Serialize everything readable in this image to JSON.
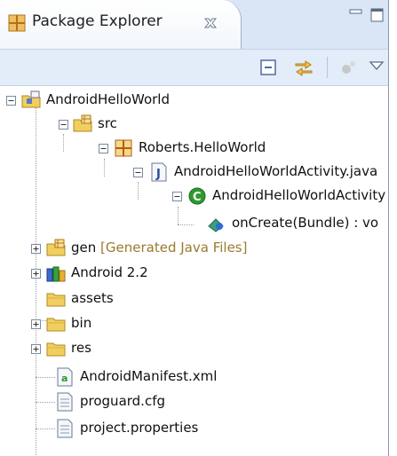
{
  "view": {
    "title": "Package Explorer",
    "tab_icon": "package-explorer-icon",
    "close_icon": "close-icon"
  },
  "toolbar": {
    "buttons": [
      "collapse-all-icon",
      "link-with-editor-icon",
      "focus-on-task-icon",
      "view-menu-icon"
    ]
  },
  "window": {
    "buttons": [
      "minimize-icon",
      "maximize-icon"
    ]
  },
  "tree": {
    "project": "AndroidHelloWorld",
    "src": "src",
    "package": "Roberts.HelloWorld",
    "java_file": "AndroidHelloWorldActivity.java",
    "class": "AndroidHelloWorldActivity",
    "method": "onCreate(Bundle) : vo",
    "gen": "gen",
    "gen_decoration": "[Generated Java Files]",
    "android_lib": "Android 2.2",
    "assets": "assets",
    "bin": "bin",
    "res": "res",
    "manifest": "AndroidManifest.xml",
    "proguard": "proguard.cfg",
    "project_properties": "project.properties"
  },
  "colors": {
    "tab_bar": "#d9e6f6",
    "toolbar": "#e3edf9",
    "decoration_text": "#9a7a2e",
    "folder": "#e8c24a",
    "class_icon": "#2e9a2e"
  }
}
